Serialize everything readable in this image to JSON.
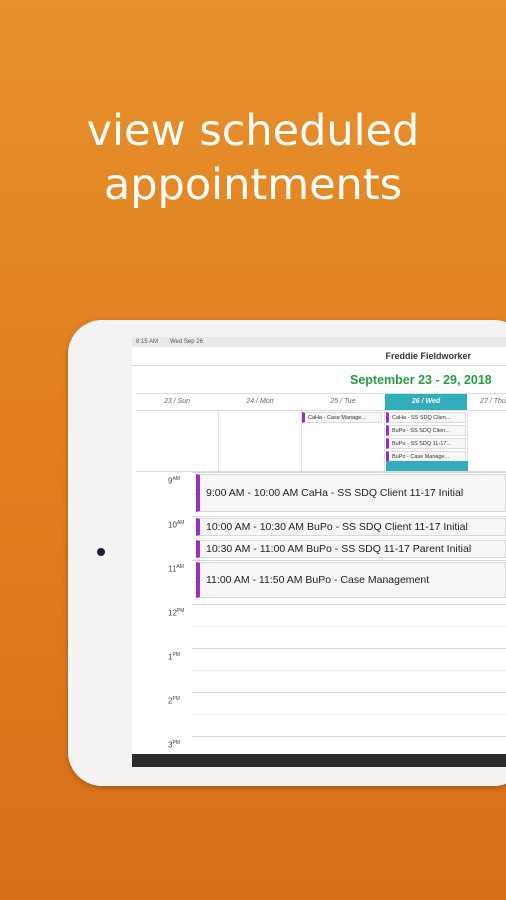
{
  "headline": {
    "line1": "view scheduled",
    "line2": "appointments"
  },
  "status": {
    "time": "8:15 AM",
    "date": "Wed Sep 26"
  },
  "app": {
    "user_name": "Freddie Fieldworker",
    "date_range": "September 23 - 29, 2018"
  },
  "week": {
    "days": [
      {
        "label": "23 / Sun",
        "active": false
      },
      {
        "label": "24 / Mon",
        "active": false
      },
      {
        "label": "25 / Tue",
        "active": false
      },
      {
        "label": "26 / Wed",
        "active": true
      },
      {
        "label": "27 / Thu",
        "active": false
      }
    ]
  },
  "allday": {
    "tue": [
      "CaHa - Case Manage..."
    ],
    "wed": [
      "CaHa - SS SDQ Clien...",
      "BuPo - SS SDQ Clien...",
      "BuPo - SS SDQ 11-17...",
      "BuPo - Case Manage..."
    ]
  },
  "hours": [
    "9",
    "10",
    "11",
    "12",
    "1",
    "2",
    "3"
  ],
  "ampm": [
    "AM",
    "AM",
    "AM",
    "PM",
    "PM",
    "PM",
    "PM"
  ],
  "events": [
    {
      "text": "9:00 AM - 10:00 AM   CaHa - SS SDQ Client 11-17 Initial"
    },
    {
      "text": "10:00 AM - 10:30 AM   BuPo - SS SDQ Client 11-17 Initial"
    },
    {
      "text": "10:30 AM - 11:00 AM   BuPo - SS SDQ 11-17 Parent Initial"
    },
    {
      "text": "11:00 AM - 11:50 AM   BuPo - Case Management"
    }
  ],
  "colors": {
    "accent": "#31adbb",
    "event_bar": "#9b2dc2",
    "range_text": "#2a9a43"
  }
}
